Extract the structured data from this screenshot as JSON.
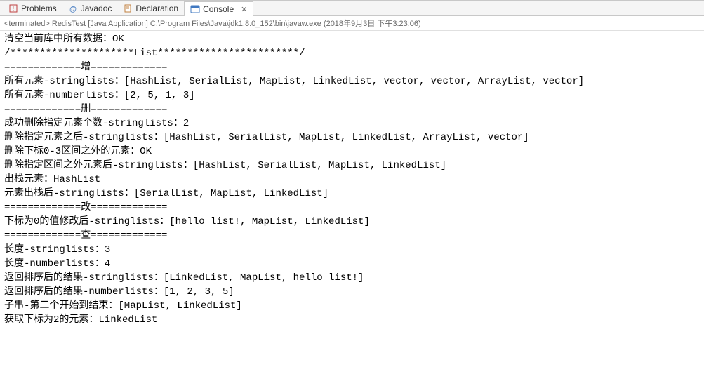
{
  "tabs": {
    "problems": "Problems",
    "javadoc": "Javadoc",
    "declaration": "Declaration",
    "console": "Console"
  },
  "status": "<terminated> RedisTest [Java Application] C:\\Program Files\\Java\\jdk1.8.0_152\\bin\\javaw.exe (2018年9月3日 下午3:23:06)",
  "output": [
    "清空当前库中所有数据：OK",
    "/*********************List************************/",
    "=============增=============",
    "所有元素-stringlists：[HashList, SerialList, MapList, LinkedList, vector, vector, ArrayList, vector]",
    "所有元素-numberlists：[2, 5, 1, 3]",
    "=============删=============",
    "成功删除指定元素个数-stringlists：2",
    "删除指定元素之后-stringlists：[HashList, SerialList, MapList, LinkedList, ArrayList, vector]",
    "删除下标0-3区间之外的元素：OK",
    "删除指定区间之外元素后-stringlists：[HashList, SerialList, MapList, LinkedList]",
    "出栈元素：HashList",
    "元素出栈后-stringlists：[SerialList, MapList, LinkedList]",
    "=============改=============",
    "下标为0的值修改后-stringlists：[hello list!, MapList, LinkedList]",
    "=============查=============",
    "长度-stringlists：3",
    "长度-numberlists：4",
    "返回排序后的结果-stringlists：[LinkedList, MapList, hello list!]",
    "返回排序后的结果-numberlists：[1, 2, 3, 5]",
    "子串-第二个开始到结束：[MapList, LinkedList]",
    "获取下标为2的元素：LinkedList"
  ]
}
